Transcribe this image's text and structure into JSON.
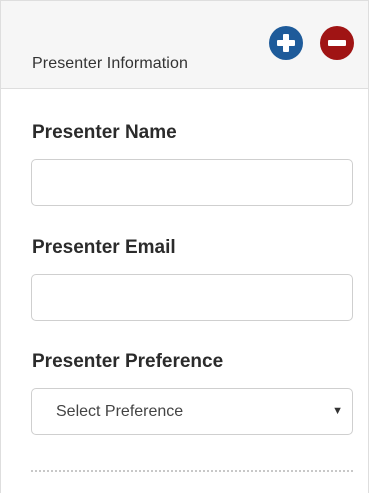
{
  "header": {
    "title": "Presenter Information",
    "add_icon": "plus-circle-icon",
    "remove_icon": "minus-circle-icon",
    "add_color": "#1e5b9a",
    "remove_color": "#a01414"
  },
  "fields": {
    "name": {
      "label": "Presenter Name",
      "value": ""
    },
    "email": {
      "label": "Presenter Email",
      "value": ""
    },
    "preference": {
      "label": "Presenter Preference",
      "selected": "Select Preference",
      "arrow": "▼"
    }
  }
}
